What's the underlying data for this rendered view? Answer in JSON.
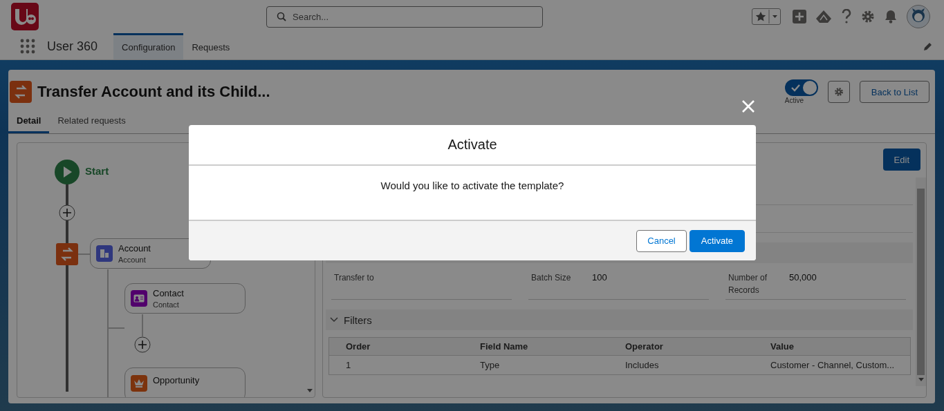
{
  "app": {
    "name": "User 360",
    "nav_tabs": [
      {
        "label": "Configuration",
        "selected": true
      },
      {
        "label": "Requests",
        "selected": false
      }
    ]
  },
  "search": {
    "placeholder": "Search..."
  },
  "record": {
    "title": "Transfer Account and its Child...",
    "active": true,
    "active_label": "Active",
    "back_button": "Back to List",
    "tabs": [
      {
        "label": "Detail",
        "selected": true
      },
      {
        "label": "Related requests",
        "selected": false
      }
    ]
  },
  "flow": {
    "start": "Start",
    "nodes": [
      {
        "title": "Account",
        "subtitle": "Account",
        "kind": "account",
        "children": [
          {
            "title": "Contact",
            "subtitle": "Contact",
            "kind": "contact"
          },
          {
            "title": "Opportunity",
            "kind": "opportunity"
          }
        ]
      }
    ]
  },
  "detail": {
    "edit_button": "Edit",
    "fields": [
      {
        "label": "Transfer to"
      },
      {
        "label": "Batch Size",
        "value": "100"
      },
      {
        "label": "Number of Records",
        "value": "50,000"
      }
    ],
    "filters": {
      "title": "Filters",
      "columns": [
        "Order",
        "Field Name",
        "Operator",
        "Value"
      ],
      "rows": [
        [
          "1",
          "Type",
          "Includes",
          "Customer - Channel, Custom..."
        ]
      ]
    }
  },
  "modal": {
    "title": "Activate",
    "message": "Would you like to activate the template?",
    "buttons": [
      "Cancel",
      "Activate"
    ]
  }
}
